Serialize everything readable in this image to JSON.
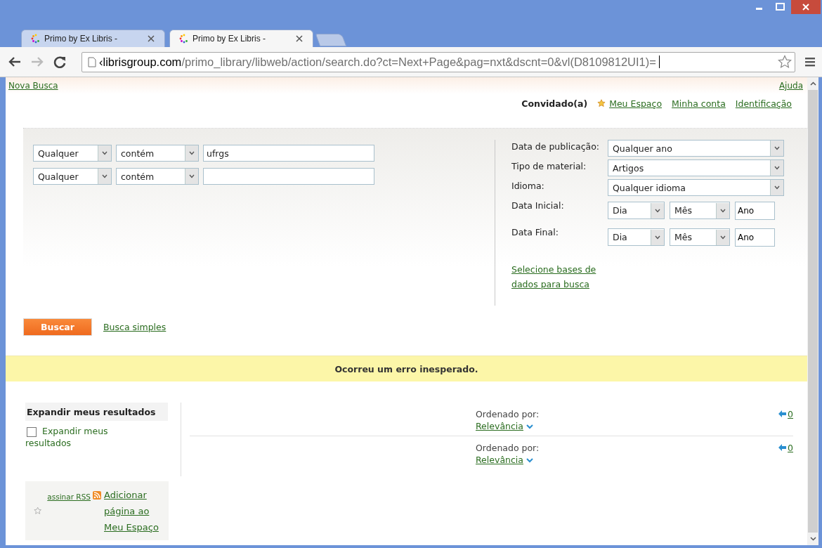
{
  "browser": {
    "tabs": [
      {
        "title": "Primo by Ex Libris -",
        "selected": false
      },
      {
        "title": "Primo by Ex Libris -",
        "selected": true
      }
    ],
    "url": {
      "host": "‹librisgroup.com",
      "path": "/primo_library/libweb/action/search.do?ct=Next+Page&pag=nxt&dscnt=0&vl(D8109812UI1)="
    }
  },
  "top_links": {
    "left": "Nova Busca",
    "right": "Ajuda"
  },
  "user_bar": {
    "guest": "Convidado(a)",
    "links": [
      {
        "label": "Meu Espaço",
        "kind": "starred"
      },
      {
        "label": "Minha conta",
        "kind": "plain"
      },
      {
        "label": "Identificação",
        "kind": "plain"
      }
    ]
  },
  "search": {
    "rows": [
      {
        "field": "Qualquer",
        "operator": "contém",
        "value": "ufrgs"
      },
      {
        "field": "Qualquer",
        "operator": "contém"
      }
    ],
    "filters": [
      {
        "kind": "select",
        "label": "Data de publicação:",
        "value": "Qualquer ano"
      },
      {
        "kind": "select",
        "label": "Tipo de material:",
        "value": "Artigos"
      },
      {
        "kind": "select",
        "label": "Idioma:",
        "value": "Qualquer idioma"
      },
      {
        "kind": "date",
        "label": "Data Inicial:",
        "day": "Dia",
        "month": "Mês",
        "year": "Ano"
      },
      {
        "kind": "date",
        "label": "Data Final:",
        "day": "Dia",
        "month": "Mês",
        "year": "Ano"
      }
    ],
    "databases_link": "Selecione bases de dados para busca",
    "search_button": "Buscar",
    "simple_search_link": "Busca simples"
  },
  "error_message": "Ocorreu um erro inesperado.",
  "sidebar": {
    "heading": "Expandir meus resultados",
    "checkbox": {
      "label": "Expandir meus resultados",
      "checked": false
    },
    "rss_link": "assinar RSS",
    "add_link": "Adicionar página ao Meu Espaço"
  },
  "sort_bars": [
    {
      "label": "Ordenado por:",
      "value": "Relevância",
      "count": "0"
    },
    {
      "label": "Ordenado por:",
      "value": "Relevância",
      "count": "0"
    }
  ]
}
